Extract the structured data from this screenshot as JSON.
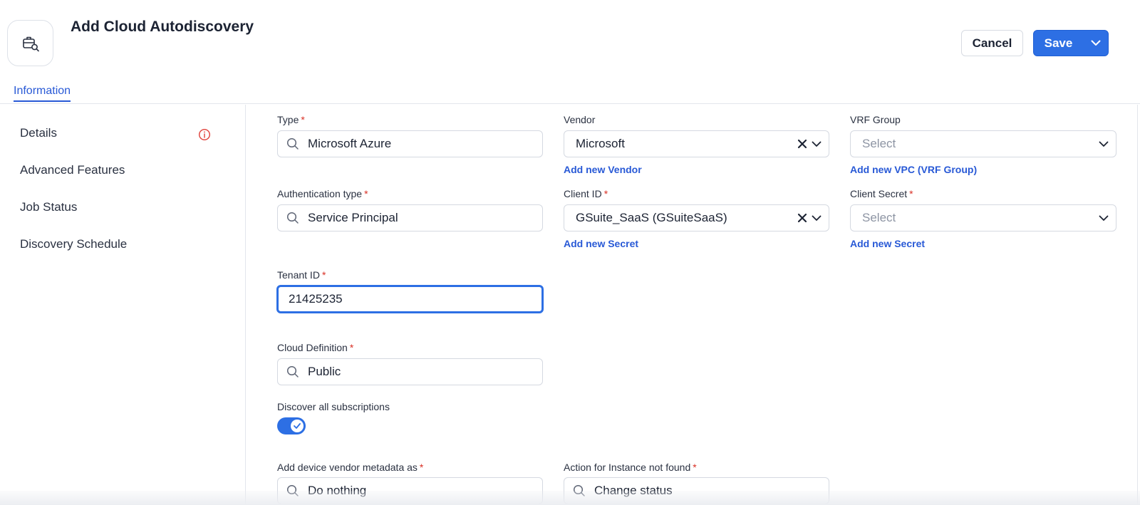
{
  "header": {
    "title": "Add Cloud Autodiscovery",
    "cancel_label": "Cancel",
    "save_label": "Save"
  },
  "tabs": [
    {
      "label": "Information"
    }
  ],
  "sidebar": {
    "items": [
      {
        "label": "Details",
        "has_warning": true
      },
      {
        "label": "Advanced Features"
      },
      {
        "label": "Job Status"
      },
      {
        "label": "Discovery Schedule"
      }
    ]
  },
  "form": {
    "type": {
      "label": "Type",
      "value": "Microsoft Azure"
    },
    "vendor": {
      "label": "Vendor",
      "value": "Microsoft",
      "link": "Add new Vendor"
    },
    "vrf_group": {
      "label": "VRF Group",
      "placeholder": "Select",
      "link": "Add new VPC (VRF Group)"
    },
    "auth_type": {
      "label": "Authentication type",
      "value": "Service Principal"
    },
    "client_id": {
      "label": "Client ID",
      "value": "GSuite_SaaS (GSuiteSaaS)",
      "link": "Add new Secret"
    },
    "client_secret": {
      "label": "Client Secret",
      "placeholder": "Select",
      "link": "Add new Secret"
    },
    "tenant_id": {
      "label": "Tenant ID",
      "value": "21425235"
    },
    "cloud_definition": {
      "label": "Cloud Definition",
      "value": "Public"
    },
    "discover_all": {
      "label": "Discover all subscriptions",
      "checked": true
    },
    "vendor_metadata": {
      "label": "Add device vendor metadata as",
      "value": "Do nothing"
    },
    "instance_not_found": {
      "label": "Action for Instance not found",
      "value": "Change status"
    }
  },
  "colors": {
    "accent": "#2d6fe4",
    "required": "#d93025",
    "link": "#2859d6",
    "warning": "#e0413a"
  }
}
